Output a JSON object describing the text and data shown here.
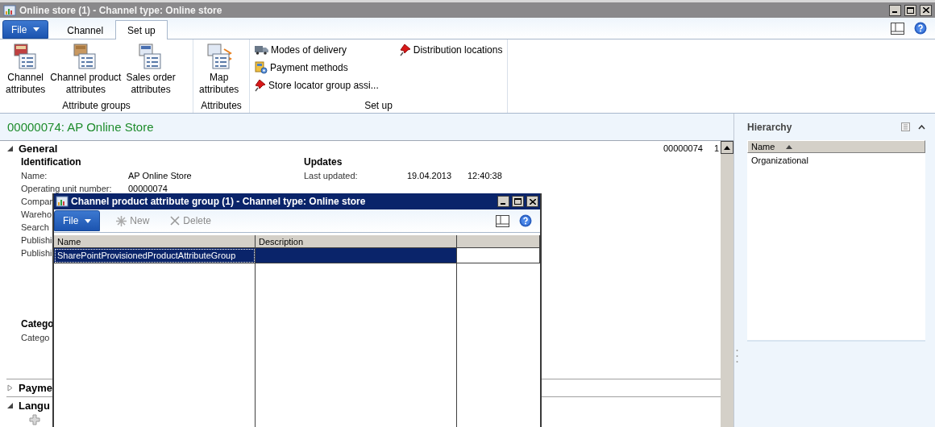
{
  "window": {
    "title": "Online store (1) - Channel type: Online store"
  },
  "ribbon": {
    "file_label": "File",
    "tabs": [
      {
        "label": "Channel",
        "selected": false
      },
      {
        "label": "Set up",
        "selected": true
      }
    ],
    "groups": [
      {
        "label": "Attribute groups",
        "kind": "large",
        "items": [
          {
            "label": "Channel\nattributes"
          },
          {
            "label": "Channel product\nattributes"
          },
          {
            "label": "Sales order\nattributes"
          }
        ]
      },
      {
        "label": "Attributes",
        "kind": "large",
        "items": [
          {
            "label": "Map\nattributes"
          }
        ]
      },
      {
        "label": "Set up",
        "kind": "small",
        "items": [
          {
            "label": "Modes of delivery"
          },
          {
            "label": "Payment methods"
          },
          {
            "label": "Store locator group assi..."
          },
          {
            "label": "Distribution locations"
          }
        ]
      }
    ]
  },
  "record": {
    "title": "00000074: AP Online Store",
    "id_column": "00000074",
    "column_2": "1",
    "sections": [
      {
        "title": "General",
        "expanded": true
      },
      {
        "title": "Payme",
        "expanded": false
      },
      {
        "title": "Langu",
        "expanded": true
      }
    ],
    "identification": {
      "heading": "Identification",
      "fields": [
        {
          "label": "Name:",
          "value": "AP Online Store"
        },
        {
          "label": "Operating unit number:",
          "value": "00000074"
        },
        {
          "label": "Compar"
        },
        {
          "label": "Wareho"
        },
        {
          "label": "Search"
        },
        {
          "label": "Publishi"
        },
        {
          "label": "Publishi"
        }
      ]
    },
    "updates": {
      "heading": "Updates",
      "fields": [
        {
          "label": "Last updated:",
          "date": "19.04.2013",
          "time": "12:40:38"
        }
      ]
    },
    "categories": {
      "heading": "Catego",
      "fields": [
        {
          "label": "Catego"
        }
      ]
    }
  },
  "hierarchy": {
    "title": "Hierarchy",
    "columns": [
      "Name"
    ],
    "rows": [
      "Organizational"
    ]
  },
  "dialog": {
    "title": "Channel product attribute group (1) - Channel type: Online store",
    "file_label": "File",
    "toolbar": [
      {
        "label": "New",
        "disabled": true
      },
      {
        "label": "Delete",
        "disabled": true
      }
    ],
    "columns": [
      "Name",
      "Description"
    ],
    "rows": [
      {
        "name": "SharePointProvisionedProductAttributeGroup",
        "selected": true
      }
    ]
  }
}
